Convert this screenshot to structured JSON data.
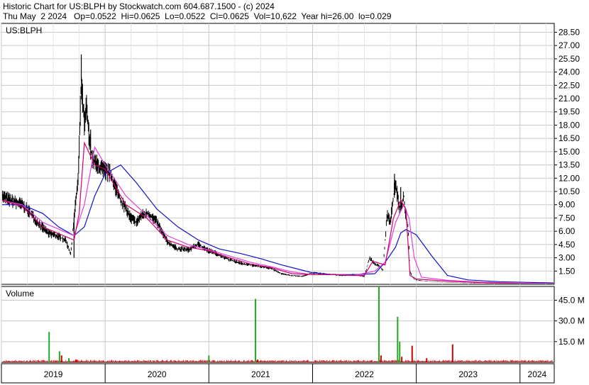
{
  "header": {
    "line1": "Historic Chart for US:BLPH by Stockwatch.com 604.687.1500 - (c) 2024",
    "line2": "Thu May  2 2024   Op=0.0522  Hi=0.0625  Lo=0.0522  Cl=0.0625  Vol=10,622  Year hi=26.00  lo=0.029"
  },
  "colors": {
    "price": "#000000",
    "ma_short": "#d4006e",
    "ma_medium": "#e040e0",
    "ma_long": "#1010c8",
    "volume_up": "#22aa22",
    "volume_down": "#cc0000",
    "grid": "#c8c8c8"
  },
  "chart_data": [
    {
      "type": "line",
      "title": "US:BLPH",
      "ylabel": "",
      "ylim": [
        0,
        29.5
      ],
      "yticks": [
        1.5,
        3.0,
        4.5,
        6.0,
        7.5,
        9.0,
        10.5,
        12.0,
        13.5,
        15.0,
        16.5,
        18.0,
        19.5,
        21.0,
        22.5,
        24.0,
        25.5,
        27.0,
        28.5
      ],
      "ytick_labels": [
        "1.50",
        "3.00",
        "4.50",
        "6.00",
        "7.50",
        "9.00",
        "10.50",
        "12.00",
        "13.50",
        "15.00",
        "16.50",
        "18.00",
        "19.50",
        "21.00",
        "22.50",
        "24.00",
        "25.50",
        "27.00",
        "28.50"
      ],
      "xlim": [
        2019.0,
        2024.33
      ],
      "xticks": [
        2019.0,
        2020.0,
        2021.0,
        2022.0,
        2023.0,
        2024.0
      ],
      "xtick_labels": [
        "2019",
        "2020",
        "2021",
        "2022",
        "2023",
        "2024"
      ],
      "grid": true,
      "series": [
        {
          "key": "price",
          "x": [
            2019.0,
            2019.1,
            2019.2,
            2019.27,
            2019.35,
            2019.45,
            2019.55,
            2019.62,
            2019.67,
            2019.7,
            2019.74,
            2019.77,
            2019.8,
            2019.82,
            2019.85,
            2019.88,
            2019.92,
            2019.97,
            2020.05,
            2020.1,
            2020.15,
            2020.2,
            2020.25,
            2020.3,
            2020.35,
            2020.42,
            2020.5,
            2020.6,
            2020.7,
            2020.8,
            2020.9,
            2021.0,
            2021.05,
            2021.1,
            2021.2,
            2021.3,
            2021.4,
            2021.5,
            2021.6,
            2021.7,
            2021.8,
            2021.9,
            2022.0,
            2022.1,
            2022.2,
            2022.3,
            2022.4,
            2022.5,
            2022.55,
            2022.6,
            2022.65,
            2022.68,
            2022.7,
            2022.72,
            2022.75,
            2022.78,
            2022.8,
            2022.83,
            2022.85,
            2022.88,
            2022.9,
            2022.92,
            2022.94,
            2022.96,
            2022.98,
            2023.0,
            2023.05,
            2023.15,
            2023.3,
            2023.5,
            2023.7,
            2023.9,
            2024.1,
            2024.33
          ],
          "y": [
            10.0,
            9.4,
            9.0,
            8.2,
            7.0,
            5.8,
            5.4,
            5.0,
            3.4,
            7.5,
            12.0,
            23.0,
            18.0,
            20.0,
            16.0,
            14.0,
            13.5,
            13.0,
            12.5,
            11.0,
            9.5,
            8.5,
            7.5,
            7.0,
            7.8,
            8.0,
            7.0,
            4.8,
            4.0,
            3.9,
            4.5,
            3.8,
            3.6,
            3.3,
            2.8,
            2.4,
            2.2,
            2.0,
            1.8,
            1.2,
            1.0,
            0.9,
            1.3,
            1.2,
            1.1,
            1.0,
            1.1,
            0.9,
            3.0,
            2.3,
            2.0,
            1.6,
            5.0,
            8.0,
            7.0,
            10.0,
            11.5,
            9.0,
            8.5,
            10.0,
            7.5,
            6.8,
            1.5,
            0.9,
            0.6,
            0.5,
            0.4,
            0.3,
            0.2,
            0.15,
            0.12,
            0.08,
            0.06,
            0.06
          ]
        },
        {
          "key": "ma_short",
          "x": [
            2019.0,
            2019.2,
            2019.4,
            2019.6,
            2019.7,
            2019.75,
            2019.8,
            2019.9,
            2020.0,
            2020.2,
            2020.4,
            2020.6,
            2020.8,
            2021.0,
            2021.2,
            2021.4,
            2021.6,
            2021.8,
            2022.0,
            2022.2,
            2022.4,
            2022.5,
            2022.58,
            2022.7,
            2022.78,
            2022.85,
            2022.9,
            2022.94,
            2023.0,
            2023.3,
            2023.6,
            2024.0,
            2024.33
          ],
          "y": [
            9.5,
            8.8,
            6.5,
            5.5,
            5.0,
            8.0,
            16.0,
            13.5,
            13.0,
            9.0,
            7.5,
            5.0,
            4.2,
            3.8,
            3.0,
            2.3,
            1.9,
            1.2,
            1.1,
            1.1,
            1.0,
            1.0,
            2.6,
            2.2,
            7.5,
            9.5,
            8.5,
            1.0,
            0.6,
            0.35,
            0.2,
            0.1,
            0.07
          ]
        },
        {
          "key": "ma_medium",
          "x": [
            2019.0,
            2019.2,
            2019.4,
            2019.6,
            2019.7,
            2019.8,
            2019.9,
            2020.0,
            2020.2,
            2020.4,
            2020.6,
            2020.8,
            2021.0,
            2021.2,
            2021.4,
            2021.6,
            2021.8,
            2022.0,
            2022.2,
            2022.4,
            2022.6,
            2022.7,
            2022.8,
            2022.88,
            2022.93,
            2022.98,
            2023.05,
            2023.3,
            2023.6,
            2024.0,
            2024.33
          ],
          "y": [
            9.5,
            9.0,
            7.0,
            6.0,
            5.5,
            9.0,
            15.5,
            13.5,
            10.0,
            7.8,
            5.5,
            4.5,
            3.9,
            3.2,
            2.5,
            2.0,
            1.4,
            1.1,
            1.1,
            1.0,
            1.5,
            2.5,
            7.0,
            9.0,
            7.5,
            3.0,
            0.8,
            0.45,
            0.25,
            0.12,
            0.08
          ]
        },
        {
          "key": "ma_long",
          "x": [
            2019.0,
            2019.2,
            2019.4,
            2019.55,
            2019.7,
            2019.8,
            2019.9,
            2020.0,
            2020.15,
            2020.3,
            2020.5,
            2020.7,
            2020.9,
            2021.1,
            2021.3,
            2021.5,
            2021.7,
            2021.9,
            2022.0,
            2022.2,
            2022.4,
            2022.6,
            2022.7,
            2022.8,
            2022.85,
            2022.9,
            2023.0,
            2023.15,
            2023.3,
            2023.5,
            2023.8,
            2024.33
          ],
          "y": [
            9.0,
            9.0,
            8.0,
            6.5,
            5.5,
            6.5,
            10.0,
            12.5,
            13.5,
            11.5,
            8.5,
            6.5,
            5.0,
            4.0,
            3.5,
            2.9,
            2.2,
            1.6,
            1.3,
            1.1,
            1.1,
            1.2,
            2.5,
            4.2,
            5.8,
            6.2,
            5.6,
            3.2,
            1.0,
            0.5,
            0.3,
            0.15
          ]
        }
      ]
    },
    {
      "type": "bar",
      "title": "Volume",
      "ylim": [
        0,
        55
      ],
      "yticks": [
        15,
        30,
        45
      ],
      "ytick_labels": [
        "15.0 M",
        "30.0 M",
        "45.0 M"
      ],
      "unit": "M",
      "bars": [
        {
          "x": 2019.46,
          "v": 22,
          "c": "up"
        },
        {
          "x": 2019.56,
          "v": 8,
          "c": "up"
        },
        {
          "x": 2019.58,
          "v": 5,
          "c": "down"
        },
        {
          "x": 2019.65,
          "v": 3,
          "c": "up"
        },
        {
          "x": 2019.72,
          "v": 2,
          "c": "down"
        },
        {
          "x": 2021.0,
          "v": 5,
          "c": "up"
        },
        {
          "x": 2021.45,
          "v": 46,
          "c": "up"
        },
        {
          "x": 2021.47,
          "v": 2,
          "c": "down"
        },
        {
          "x": 2022.64,
          "v": 60,
          "c": "up"
        },
        {
          "x": 2022.66,
          "v": 5,
          "c": "down"
        },
        {
          "x": 2022.82,
          "v": 33,
          "c": "up"
        },
        {
          "x": 2022.84,
          "v": 15,
          "c": "up"
        },
        {
          "x": 2022.86,
          "v": 4,
          "c": "down"
        },
        {
          "x": 2022.96,
          "v": 12,
          "c": "down"
        },
        {
          "x": 2023.1,
          "v": 3,
          "c": "down"
        },
        {
          "x": 2023.35,
          "v": 13,
          "c": "down"
        }
      ]
    }
  ]
}
